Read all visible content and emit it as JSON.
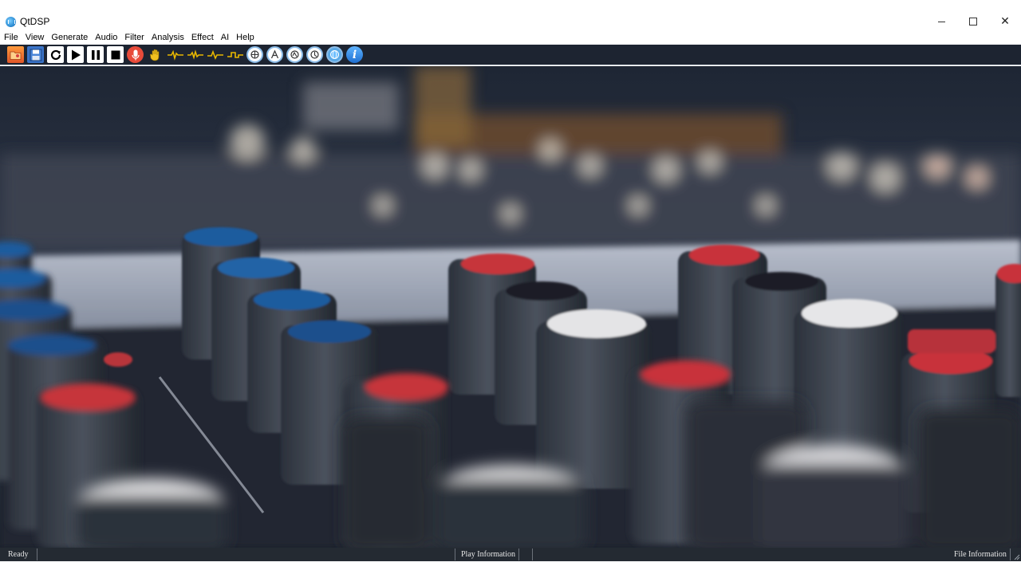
{
  "window": {
    "title": "QtDSP",
    "controls": {
      "minimize_icon": "minimize-icon",
      "maximize_icon": "maximize-icon",
      "close_icon": "close-icon",
      "close_glyph": "✕"
    }
  },
  "menu": {
    "items": [
      "File",
      "View",
      "Generate",
      "Audio",
      "Filter",
      "Analysis",
      "Effect",
      "AI",
      "Help"
    ]
  },
  "toolbar": {
    "icons": [
      "open-folder-icon",
      "save-icon",
      "reload-icon",
      "play-icon",
      "pause-icon",
      "stop-icon",
      "record-microphone-icon",
      "hand-icon",
      "waveform-icon-1",
      "waveform-icon-2",
      "waveform-icon-3",
      "waveform-icon-4",
      "analysis-icon-1",
      "analysis-icon-2",
      "analysis-icon-3",
      "analysis-icon-4",
      "globe-icon",
      "info-icon"
    ],
    "info_glyph": "i",
    "colors": {
      "background": "#1d2431",
      "waveform": "#e8b700"
    }
  },
  "background_image": "audio-mixer-knobs-photo",
  "status": {
    "ready": "Ready",
    "play_info": "Play Information",
    "file_info": "File Information"
  }
}
